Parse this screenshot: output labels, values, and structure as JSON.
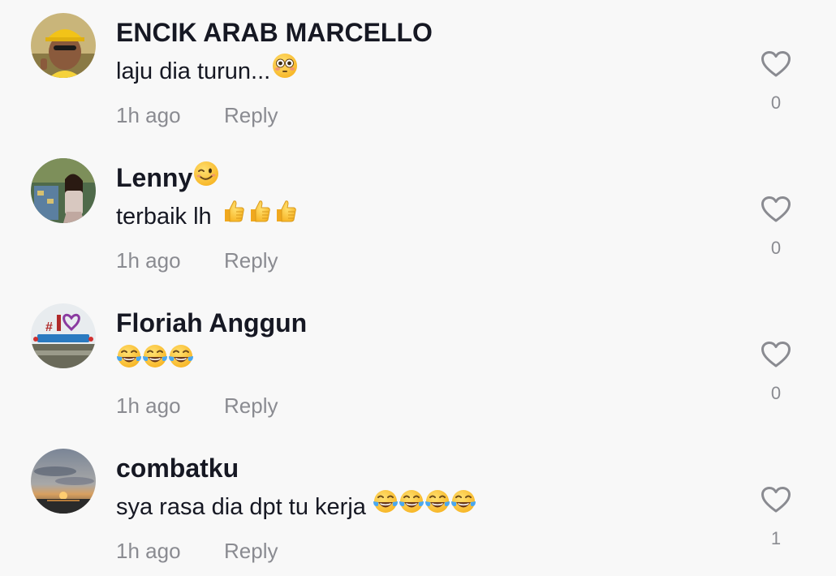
{
  "comments": [
    {
      "username": "ENCIK ARAB MARCELLO",
      "username_emoji": "",
      "text": "laju dia turun...",
      "text_emojis": [
        "flushed-face-emoji"
      ],
      "time": "1h ago",
      "reply_label": "Reply",
      "like_count": "0"
    },
    {
      "username": "Lenny",
      "username_emoji": "winking-face-emoji",
      "text": "terbaik lh",
      "text_emojis": [
        "thumbs-up-emoji",
        "thumbs-up-emoji",
        "thumbs-up-emoji"
      ],
      "time": "1h ago",
      "reply_label": "Reply",
      "like_count": "0"
    },
    {
      "username": "Floriah Anggun",
      "username_emoji": "",
      "text": "",
      "text_emojis": [
        "tears-of-joy-emoji",
        "tears-of-joy-emoji",
        "tears-of-joy-emoji"
      ],
      "time": "1h ago",
      "reply_label": "Reply",
      "like_count": "0"
    },
    {
      "username": "combatku",
      "username_emoji": "",
      "text": "sya rasa dia dpt tu kerja",
      "text_emojis": [
        "tears-of-joy-emoji",
        "tears-of-joy-emoji",
        "tears-of-joy-emoji",
        "tears-of-joy-emoji"
      ],
      "time": "1h ago",
      "reply_label": "Reply",
      "like_count": "1"
    }
  ],
  "colors": {
    "background": "#f8f8f8",
    "text_primary": "#161823",
    "text_secondary": "#8a8b91",
    "emoji_yellow": "#ffc93a",
    "tear_blue": "#4aa8f0"
  },
  "icons": {
    "like": "heart-outline-icon"
  }
}
